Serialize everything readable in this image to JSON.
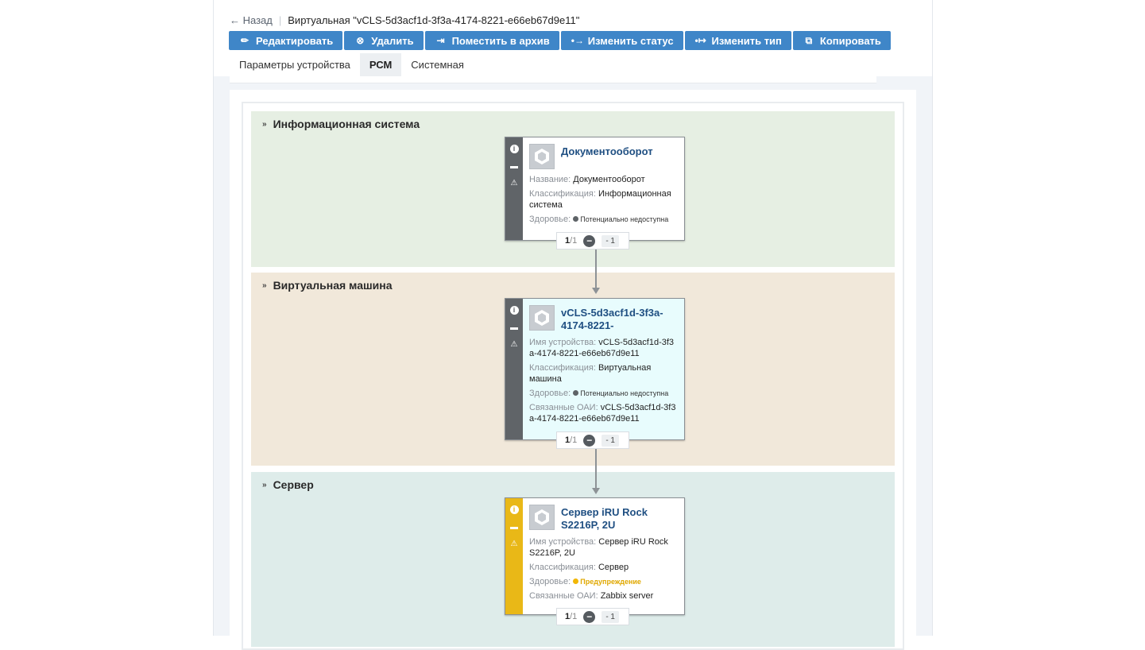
{
  "breadcrumb": {
    "back": "← Назад",
    "separator": "|",
    "title": "Виртуальная \"vCLS-5d3acf1d-3f3a-4174-8221-e66eb67d9e11\""
  },
  "toolbar": [
    {
      "icon": "pencil-icon",
      "glyph": "✏",
      "label": "Редактировать"
    },
    {
      "icon": "delete-circle-icon",
      "glyph": "⊗",
      "label": "Удалить"
    },
    {
      "icon": "archive-icon",
      "glyph": "⇥",
      "label": "Поместить в архив"
    },
    {
      "icon": "status-change-icon",
      "glyph": "•→",
      "label": "Изменить статус"
    },
    {
      "icon": "type-change-icon",
      "glyph": "•↦",
      "label": "Изменить тип"
    },
    {
      "icon": "copy-icon",
      "glyph": "⧉",
      "label": "Копировать"
    }
  ],
  "tabs": [
    {
      "label": "Параметры устройства",
      "active": false
    },
    {
      "label": "РСМ",
      "active": true
    },
    {
      "label": "Системная",
      "active": false
    }
  ],
  "colors": {
    "accent": "#3f86c8",
    "band_info": "#e6efe3",
    "band_vm": "#f1e8da",
    "band_server": "#deecea",
    "card_vm_bg": "#e8fcfd",
    "warning": "#e9b817"
  },
  "bands": [
    {
      "title": "Информационная система",
      "card": {
        "title": "Документооборот",
        "props": [
          {
            "k": "Название: ",
            "v": "Документооборот"
          },
          {
            "k": "Классификация: ",
            "v": "Информационная система"
          }
        ],
        "health_key": "Здоровье: ",
        "health_value": "Потенциально недоступна",
        "pager": {
          "current": "1",
          "total": "/1",
          "level": "- 1"
        }
      }
    },
    {
      "title": "Виртуальная машина",
      "card": {
        "title": "vCLS-5d3acf1d-3f3a-4174-8221-",
        "props": [
          {
            "k": "Имя устройства: ",
            "v": "vCLS-5d3acf1d-3f3a-4174-8221-e66eb67d9e11"
          },
          {
            "k": "Классификация: ",
            "v": "Виртуальная машина"
          }
        ],
        "health_key": "Здоровье: ",
        "health_value": "Потенциально недоступна",
        "extra": {
          "k": "Связанные ОАИ: ",
          "v": "vCLS-5d3acf1d-3f3a-4174-8221-e66eb67d9e11"
        },
        "pager": {
          "current": "1",
          "total": "/1",
          "level": "- 1"
        }
      }
    },
    {
      "title": "Сервер",
      "card": {
        "title": "Сервер iRU Rock S2216P, 2U",
        "props": [
          {
            "k": "Имя устройства: ",
            "v": "Сервер iRU Rock S2216P, 2U"
          },
          {
            "k": "Классификация: ",
            "v": "Сервер"
          }
        ],
        "health_key": "Здоровье: ",
        "health_value": "Предупреждение",
        "extra": {
          "k": "Связанные ОАИ: ",
          "v": "Zabbix server"
        },
        "pager": {
          "current": "1",
          "total": "/1",
          "level": "- 1"
        }
      }
    }
  ]
}
